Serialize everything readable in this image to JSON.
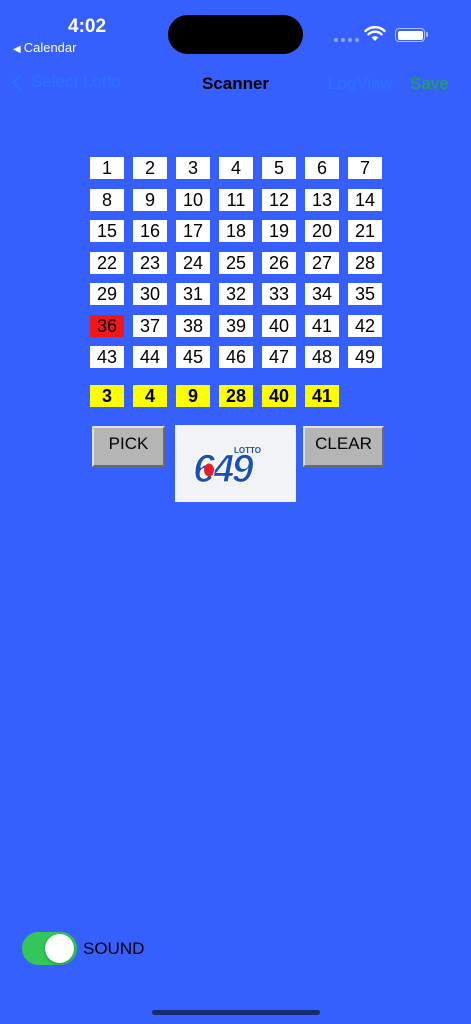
{
  "status_bar": {
    "time": "4:02",
    "back_app": "Calendar"
  },
  "nav": {
    "back_label": "Select Lotto",
    "title": "Scanner",
    "logview_label": "LogView",
    "save_label": "Save"
  },
  "grid": {
    "rows": [
      [
        "1",
        "2",
        "3",
        "4",
        "5",
        "6",
        "7"
      ],
      [
        "8",
        "9",
        "10",
        "11",
        "12",
        "13",
        "14"
      ],
      [
        "15",
        "16",
        "17",
        "18",
        "19",
        "20",
        "21"
      ],
      [
        "22",
        "23",
        "24",
        "25",
        "26",
        "27",
        "28"
      ],
      [
        "29",
        "30",
        "31",
        "32",
        "33",
        "34",
        "35"
      ],
      [
        "36",
        "37",
        "38",
        "39",
        "40",
        "41",
        "42"
      ],
      [
        "43",
        "44",
        "45",
        "46",
        "47",
        "48",
        "49"
      ]
    ],
    "highlighted": "36",
    "highlight_color": "#F0161A"
  },
  "picked_numbers": [
    "3",
    "4",
    "9",
    "28",
    "40",
    "41"
  ],
  "buttons": {
    "pick_label": "PICK",
    "clear_label": "CLEAR"
  },
  "logo": {
    "name": "lotto-649-logo",
    "word": "LOTTO",
    "digits": "649"
  },
  "sound": {
    "label": "SOUND",
    "enabled": true
  },
  "colors": {
    "background": "#3660FE",
    "picked": "#FFFF00",
    "toggle_on": "#33C759",
    "link": "#2A73FF",
    "save": "#1FA84A"
  }
}
